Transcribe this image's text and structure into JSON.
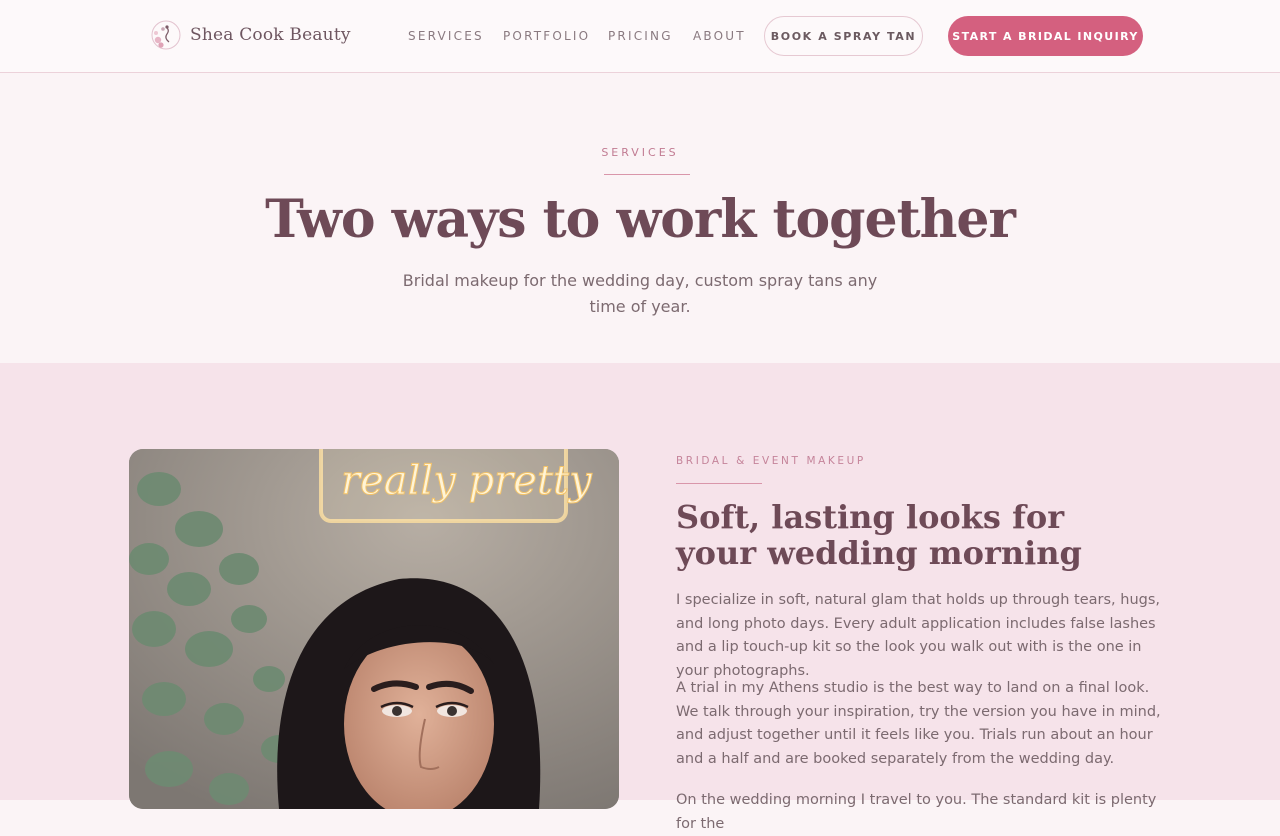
{
  "brand": {
    "name": "Shea Cook Beauty"
  },
  "nav": {
    "items": [
      "SERVICES",
      "PORTFOLIO",
      "PRICING",
      "ABOUT"
    ],
    "book_label": "BOOK A SPRAY TAN",
    "inquiry_label": "START A BRIDAL INQUIRY"
  },
  "intro": {
    "eyebrow": "SERVICES",
    "title": "Two ways to work together",
    "subtitle": "Bridal makeup for the wedding day, custom spray tans any time of year."
  },
  "service": {
    "eyebrow": "BRIDAL & EVENT MAKEUP",
    "title": "Soft, lasting looks for your wedding morning",
    "paragraphs": [
      "I specialize in soft, natural glam that holds up through tears, hugs, and long photo days. Every adult application includes false lashes and a lip touch-up kit so the look you walk out with is the one in your photographs.",
      "A trial in my Athens studio is the best way to land on a final look. We talk through your inspiration, try the version you have in mind, and adjust together until it feels like you. Trials run about an hour and a half and are booked separately from the wedding day.",
      "On the wedding morning I travel to you. The standard kit is plenty for the"
    ],
    "photo_sign": "really pretty"
  },
  "colors": {
    "accent": "#d4607f",
    "heading": "#6e4a57",
    "section_bg": "#f6e3ea"
  }
}
